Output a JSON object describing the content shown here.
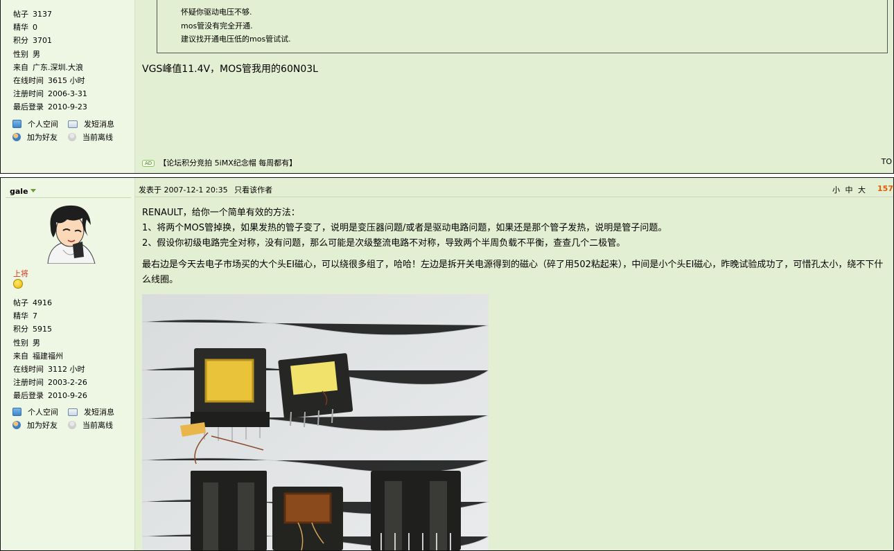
{
  "post1": {
    "stats": [
      {
        "label": "帖子",
        "value": "3137"
      },
      {
        "label": "精华",
        "value": "0"
      },
      {
        "label": "积分",
        "value": "3701"
      },
      {
        "label": "性别",
        "value": "男"
      },
      {
        "label": "来自",
        "value": "广东.深圳.大浪"
      },
      {
        "label": "在线时间",
        "value": "3615 小时"
      },
      {
        "label": "注册时间",
        "value": "2006-3-31"
      },
      {
        "label": "最后登录",
        "value": "2010-9-23"
      }
    ],
    "actions": {
      "space": "个人空间",
      "pm": "发短消息",
      "add_friend": "加为好友",
      "status": "当前离线"
    },
    "quote_lines": [
      "怀疑你驱动电压不够.",
      "mos管没有完全开通.",
      "建议找开通电压低的mos管试试."
    ],
    "message": "VGS峰值11.4V，MOS管我用的60N03L",
    "ad_badge": "AD",
    "ad_text": "【论坛积分竞拍 5iMX纪念帽 每周都有】",
    "top_link": "TO"
  },
  "post2": {
    "author": "gale",
    "rank": "上将",
    "stats": [
      {
        "label": "帖子",
        "value": "4916"
      },
      {
        "label": "精华",
        "value": "7"
      },
      {
        "label": "积分",
        "value": "5915"
      },
      {
        "label": "性别",
        "value": "男"
      },
      {
        "label": "来自",
        "value": "福建福州"
      },
      {
        "label": "在线时间",
        "value": "3112 小时"
      },
      {
        "label": "注册时间",
        "value": "2003-2-26"
      },
      {
        "label": "最后登录",
        "value": "2010-9-26"
      }
    ],
    "actions": {
      "space": "个人空间",
      "pm": "发短消息",
      "add_friend": "加为好友",
      "status": "当前离线"
    },
    "posted_at": "发表于 2007-12-1 20:35",
    "only_author": "只看该作者",
    "font_sizes": "小 中 大",
    "floor": "157",
    "lines": [
      "RENAULT，给你一个简单有效的方法：",
      "1、将两个MOS管掉换，如果发热的管子变了，说明是变压器问题/或者是驱动电路问题，如果还是那个管子发热，说明是管子问题。",
      "2、假设你初级电路完全对称，没有问题，那么可能是次级整流电路不对称，导致两个半周负载不平衡，查查几个二极管。"
    ],
    "paragraph": "最右边是今天去电子市场买的大个头EI磁心，可以绕很多组了，哈哈！左边是拆开关电源得到的磁心（碎了用502粘起来），中间是小个头EI磁心，昨晚试验成功了，可惜孔太小，绕不下什么线圈。"
  },
  "icons": [
    "home-icon",
    "message-icon",
    "add-friend-icon",
    "offline-icon",
    "smiley-icon",
    "caret-down-icon"
  ]
}
